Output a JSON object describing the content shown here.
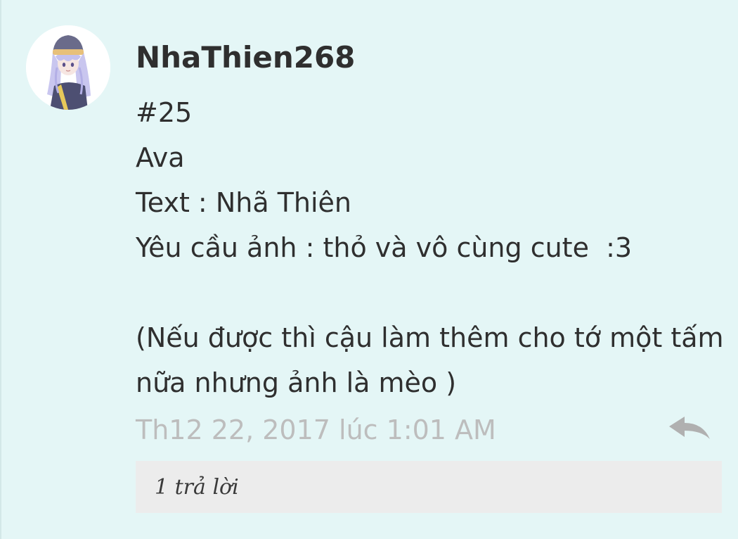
{
  "comment": {
    "author": "NhaThien268",
    "lines": [
      "#25",
      "Ava",
      "Text : Nhã Thiên",
      "Yêu cầu ảnh : thỏ và vô cùng cute  :3",
      "",
      "(Nếu được thì cậu làm thêm cho tớ một tấm",
      "nữa nhưng ảnh là mèo )"
    ],
    "timestamp": "Th12 22, 2017 lúc 1:01 AM",
    "replies_label": "1 trả lời",
    "reply_icon": "reply-arrow-icon",
    "avatar_icon": "anime-girl-avatar"
  },
  "colors": {
    "background": "#e4f6f6",
    "text": "#2f2f2f",
    "timestamp": "#bdbdbd",
    "replies_bar": "#ececec",
    "reply_icon": "#b0b0b0"
  }
}
